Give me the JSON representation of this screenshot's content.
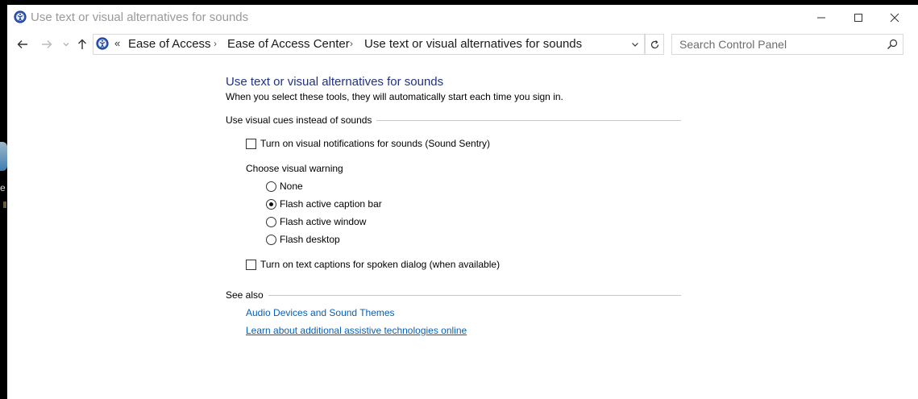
{
  "window": {
    "title": "Use text or visual alternatives for sounds"
  },
  "nav": {
    "breadcrumb_overflow": "«",
    "breadcrumbs": [
      "Ease of Access",
      "Ease of Access Center",
      "Use text or visual alternatives for sounds"
    ],
    "search_placeholder": "Search Control Panel"
  },
  "main": {
    "title": "Use text or visual alternatives for sounds",
    "subtitle": "When you select these tools, they will automatically start each time you sign in.",
    "section_visual": {
      "heading": "Use visual cues instead of sounds",
      "sound_sentry": {
        "label": "Turn on visual notifications for sounds (Sound Sentry)",
        "checked": false
      },
      "warning_label": "Choose visual warning",
      "warning_options": [
        {
          "label": "None",
          "selected": false
        },
        {
          "label": "Flash active caption bar",
          "selected": true
        },
        {
          "label": "Flash active window",
          "selected": false
        },
        {
          "label": "Flash desktop",
          "selected": false
        }
      ],
      "text_captions": {
        "label": "Turn on text captions for spoken dialog (when available)",
        "checked": false
      }
    },
    "see_also": {
      "heading": "See also",
      "links": [
        "Audio Devices and Sound Themes",
        "Learn about additional assistive technologies online"
      ]
    }
  },
  "desktop": {
    "partial_label": "e"
  },
  "colors": {
    "title_blue": "#1e3287",
    "link_blue": "#0a5eb5"
  }
}
